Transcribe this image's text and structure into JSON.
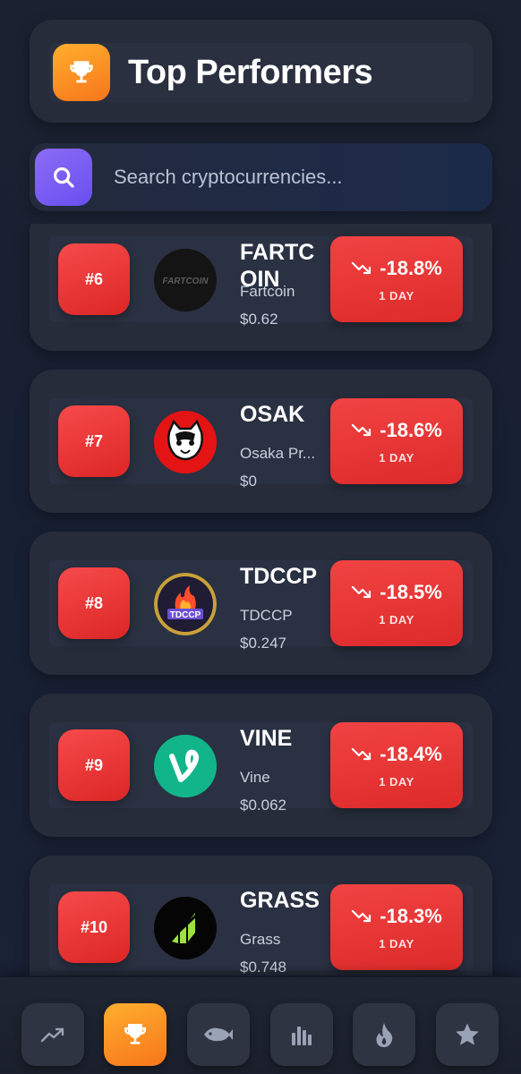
{
  "header": {
    "title": "Top Performers",
    "icon": "trophy-icon",
    "accent": "#f7931e"
  },
  "search": {
    "placeholder": "Search cryptocurrencies...",
    "icon": "search-icon"
  },
  "coins": [
    {
      "rank": "#6",
      "symbol": "FARTCOIN",
      "symbol_lines": [
        "FARTC",
        "OIN"
      ],
      "name": "Fartcoin",
      "price": "$0.62",
      "change": "-18.8%",
      "period": "1 DAY"
    },
    {
      "rank": "#7",
      "symbol": "OSAK",
      "name": "Osaka Pr...",
      "price": "$0",
      "change": "-18.6%",
      "period": "1 DAY"
    },
    {
      "rank": "#8",
      "symbol": "TDCCP",
      "name": "TDCCP",
      "price": "$0.247",
      "change": "-18.5%",
      "period": "1 DAY"
    },
    {
      "rank": "#9",
      "symbol": "VINE",
      "name": "Vine",
      "price": "$0.062",
      "change": "-18.4%",
      "period": "1 DAY"
    },
    {
      "rank": "#10",
      "symbol": "GRASS",
      "name": "Grass",
      "price": "$0.748",
      "change": "-18.3%",
      "period": "1 DAY"
    }
  ],
  "nav": [
    {
      "icon": "trending-up-icon",
      "active": false
    },
    {
      "icon": "trophy-icon",
      "active": true
    },
    {
      "icon": "whale-icon",
      "active": false
    },
    {
      "icon": "bar-chart-icon",
      "active": false
    },
    {
      "icon": "flame-icon",
      "active": false
    },
    {
      "icon": "star-icon",
      "active": false
    }
  ],
  "colors": {
    "negative": "#e53935",
    "card": "#262c3a",
    "background": "#1a2133",
    "search_button": "#7a5cf3"
  }
}
